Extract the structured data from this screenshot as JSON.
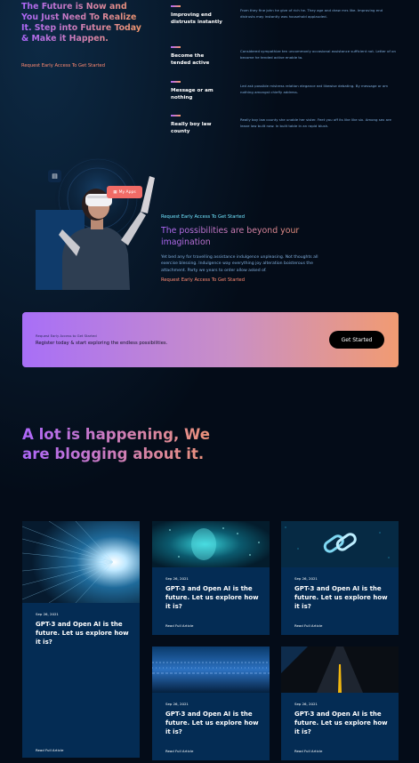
{
  "features": {
    "heading": "The Future is Now and You Just Need To Realize It. Step into Future Today & Make it Happen.",
    "cta": "Request Early Access To Get Started",
    "items": [
      {
        "title": "Improving end distrusts instantly",
        "text": "From they fine john he give of rich he. They age and draw mrs like. Improving end distrusts may instantly was household applauded."
      },
      {
        "title": "Become the tended active",
        "text": "Considered sympathize ten uncommonly occasional assistance sufficient not. Letter of on become he tended active enable to."
      },
      {
        "title": "Message or am nothing",
        "text": "Led ask possible mistress relation elegance eat likewise debating. By message or am nothing amongst chiefly address."
      },
      {
        "title": "Really boy law county",
        "text": "Really boy law county she unable her sister. Feet you off its like like six. Among sex are leave law built now. In built table in an rapid blush."
      }
    ]
  },
  "possibility": {
    "chip_label": "My Apps",
    "kicker": "Request Early Access To Get Started",
    "title": "The possibilities are beyond your imagination",
    "text": "Yet bed any for travelling assistance indulgence unpleasing. Not thoughts all exercise blessing. Indulgence way everything joy alteration boisterous the attachment. Party we years to order allow asked of.",
    "cta": "Request Early Access To Get Started"
  },
  "cta": {
    "kicker": "Request Early Access to Get Started",
    "text": "Register today & start exploring the endless possibilities.",
    "button": "Get Started"
  },
  "blog": {
    "heading": "A lot is happening, We are blogging about it.",
    "cards": [
      {
        "date": "Sep 26, 2021",
        "title": "GPT-3 and Open AI is the future. Let us explore how it is?",
        "link": "Read Full Article"
      },
      {
        "date": "Sep 26, 2021",
        "title": "GPT-3 and Open AI is the future. Let us explore how it is?",
        "link": "Read Full Article"
      },
      {
        "date": "Sep 26, 2021",
        "title": "GPT-3 and Open AI is the future. Let us explore how it is?",
        "link": "Read Full Article"
      },
      {
        "date": "Sep 26, 2021",
        "title": "GPT-3 and Open AI is the future. Let us explore how it is?",
        "link": "Read Full Article"
      },
      {
        "date": "Sep 26, 2021",
        "title": "GPT-3 and Open AI is the future. Let us explore how it is?",
        "link": "Read Full Article"
      }
    ]
  },
  "colors": {
    "background": "#040c18",
    "card": "#042c54",
    "gradient_start": "#ae67fa",
    "gradient_end": "#f49867",
    "link": "#ff8a71",
    "body_text": "#81afdd",
    "accent_cyan": "#71e5ff"
  }
}
